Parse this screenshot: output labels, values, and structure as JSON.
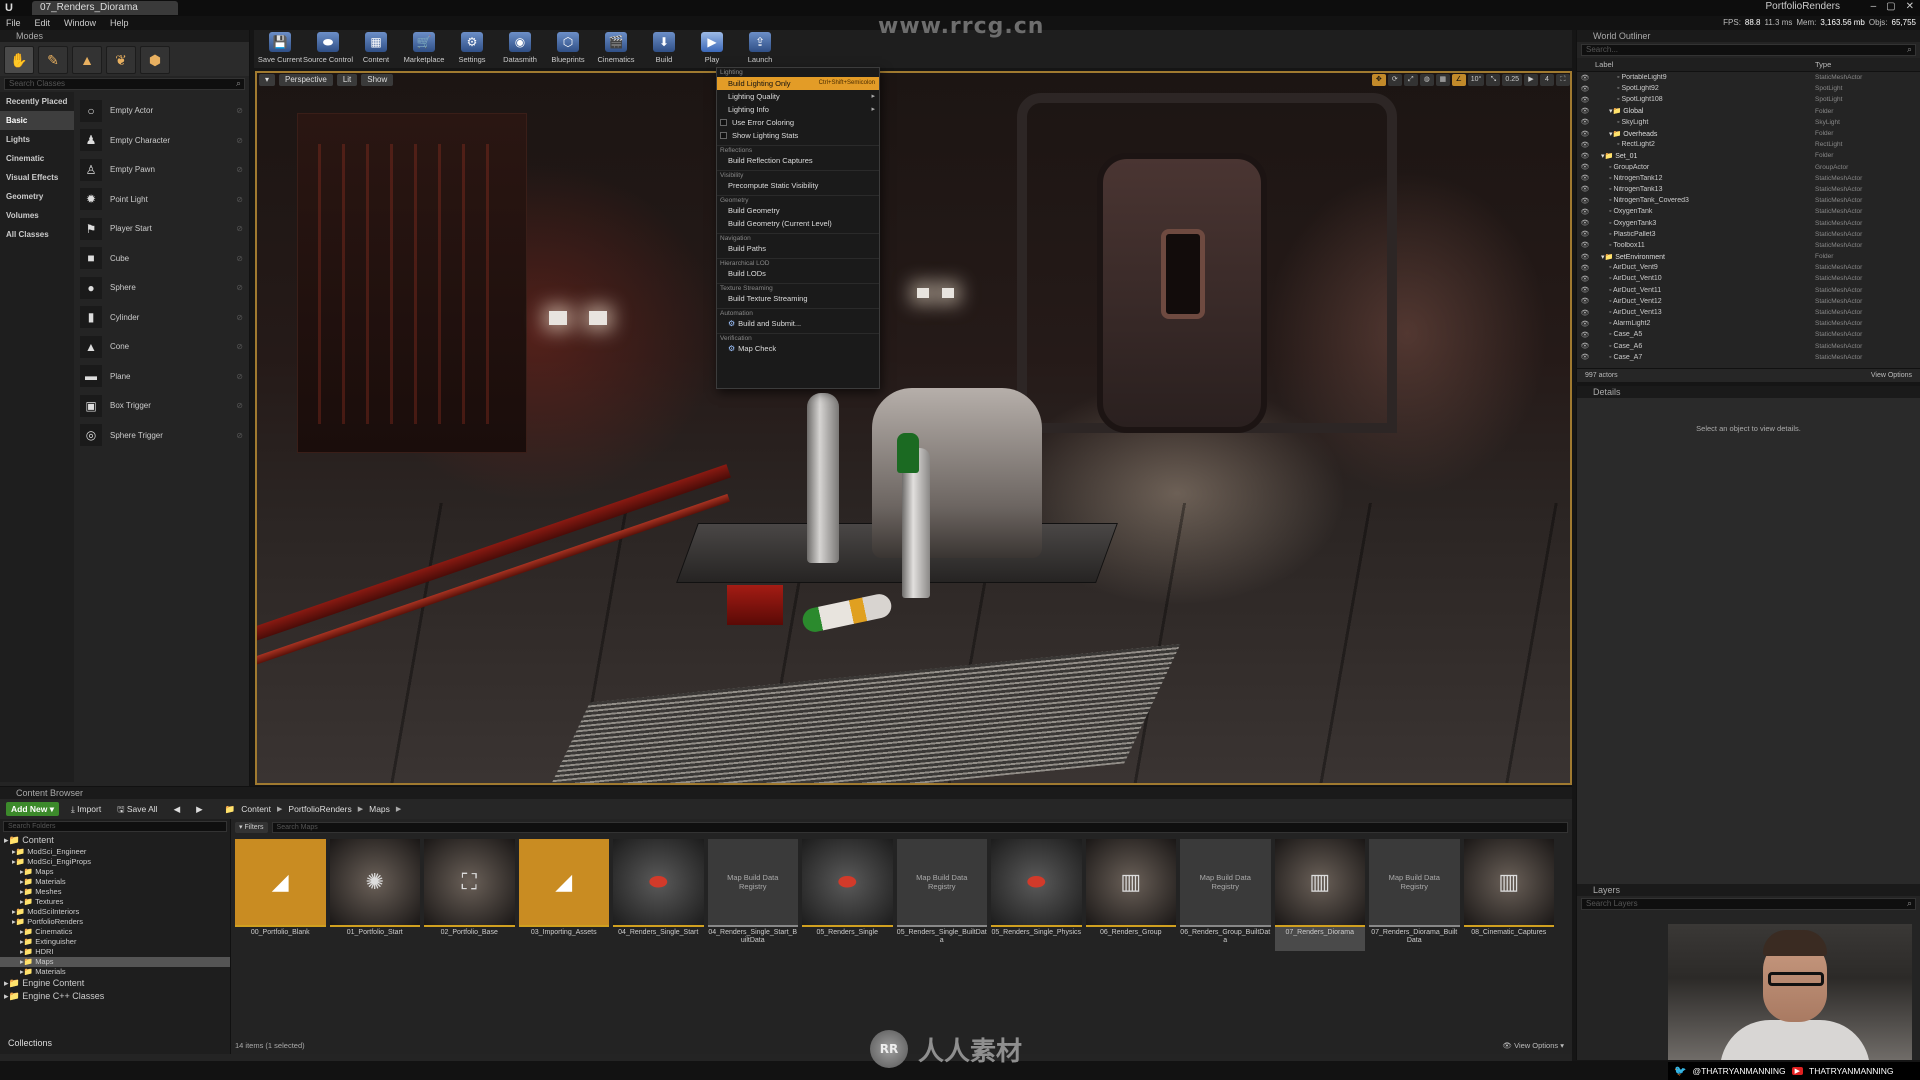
{
  "titlebar": {
    "tab": "07_Renders_Diorama",
    "project": "PortfolioRenders"
  },
  "menu": [
    "File",
    "Edit",
    "Window",
    "Help"
  ],
  "stats": {
    "fps_label": "FPS:",
    "fps": "88.8",
    "ms": "11.3 ms",
    "mem_label": "Mem:",
    "mem": "3,163.56 mb",
    "objs_label": "Objs:",
    "objs": "65,755"
  },
  "modes": {
    "tab": "Modes",
    "search_placeholder": "Search Classes",
    "categories": [
      "Recently Placed",
      "Basic",
      "Lights",
      "Cinematic",
      "Visual Effects",
      "Geometry",
      "Volumes",
      "All Classes"
    ],
    "actors": [
      "Empty Actor",
      "Empty Character",
      "Empty Pawn",
      "Point Light",
      "Player Start",
      "Cube",
      "Sphere",
      "Cylinder",
      "Cone",
      "Plane",
      "Box Trigger",
      "Sphere Trigger"
    ]
  },
  "toolbar": {
    "buttons": [
      "Save Current",
      "Source Control",
      "Content",
      "Marketplace",
      "Settings",
      "Datasmith",
      "Blueprints",
      "Cinematics",
      "Build",
      "Play",
      "Launch"
    ]
  },
  "watermark": {
    "top": "www.rrcg.cn",
    "bottom": "人人素材"
  },
  "viewport": {
    "perspective": "Perspective",
    "lit": "Lit",
    "show": "Show",
    "snap_angle": "10°",
    "scale": "0.25",
    "cam_speed": "4"
  },
  "build_menu": {
    "sections": [
      {
        "title": "Lighting",
        "items": [
          "Build Lighting Only",
          "Lighting Quality",
          "Lighting Info",
          "Use Error Coloring",
          "Show Lighting Stats"
        ]
      },
      {
        "title": "Reflections",
        "items": [
          "Build Reflection Captures"
        ]
      },
      {
        "title": "Visibility",
        "items": [
          "Precompute Static Visibility"
        ]
      },
      {
        "title": "Geometry",
        "items": [
          "Build Geometry",
          "Build Geometry (Current Level)"
        ]
      },
      {
        "title": "Navigation",
        "items": [
          "Build Paths"
        ]
      },
      {
        "title": "Hierarchical LOD",
        "items": [
          "Build LODs"
        ]
      },
      {
        "title": "Texture Streaming",
        "items": [
          "Build Texture Streaming"
        ]
      },
      {
        "title": "Automation",
        "items": [
          "Build and Submit..."
        ]
      },
      {
        "title": "Verification",
        "items": [
          "Map Check"
        ]
      }
    ],
    "shortcut": "Ctrl+Shift+Semicolon"
  },
  "outliner": {
    "tab": "World Outliner",
    "search_placeholder": "Search...",
    "col_label": "Label",
    "col_type": "Type",
    "rows": [
      {
        "name": "PortableLight9",
        "type": "StaticMeshActor",
        "indent": 3
      },
      {
        "name": "SpotLight92",
        "type": "SpotLight",
        "indent": 3
      },
      {
        "name": "SpotLight108",
        "type": "SpotLight",
        "indent": 3
      },
      {
        "name": "Global",
        "type": "Folder",
        "indent": 2
      },
      {
        "name": "SkyLight",
        "type": "SkyLight",
        "indent": 3
      },
      {
        "name": "Overheads",
        "type": "Folder",
        "indent": 2
      },
      {
        "name": "RectLight2",
        "type": "RectLight",
        "indent": 3
      },
      {
        "name": "Set_01",
        "type": "Folder",
        "indent": 1
      },
      {
        "name": "GroupActor",
        "type": "GroupActor",
        "indent": 2
      },
      {
        "name": "NitrogenTank12",
        "type": "StaticMeshActor",
        "indent": 2
      },
      {
        "name": "NitrogenTank13",
        "type": "StaticMeshActor",
        "indent": 2
      },
      {
        "name": "NitrogenTank_Covered3",
        "type": "StaticMeshActor",
        "indent": 2
      },
      {
        "name": "OxygenTank",
        "type": "StaticMeshActor",
        "indent": 2
      },
      {
        "name": "OxygenTank3",
        "type": "StaticMeshActor",
        "indent": 2
      },
      {
        "name": "PlasticPallet3",
        "type": "StaticMeshActor",
        "indent": 2
      },
      {
        "name": "Toolbox11",
        "type": "StaticMeshActor",
        "indent": 2
      },
      {
        "name": "SetEnvironment",
        "type": "Folder",
        "indent": 1
      },
      {
        "name": "AirDuct_Vent9",
        "type": "StaticMeshActor",
        "indent": 2
      },
      {
        "name": "AirDuct_Vent10",
        "type": "StaticMeshActor",
        "indent": 2
      },
      {
        "name": "AirDuct_Vent11",
        "type": "StaticMeshActor",
        "indent": 2
      },
      {
        "name": "AirDuct_Vent12",
        "type": "StaticMeshActor",
        "indent": 2
      },
      {
        "name": "AirDuct_Vent13",
        "type": "StaticMeshActor",
        "indent": 2
      },
      {
        "name": "AlarmLight2",
        "type": "StaticMeshActor",
        "indent": 2
      },
      {
        "name": "Case_A5",
        "type": "StaticMeshActor",
        "indent": 2
      },
      {
        "name": "Case_A6",
        "type": "StaticMeshActor",
        "indent": 2
      },
      {
        "name": "Case_A7",
        "type": "StaticMeshActor",
        "indent": 2
      }
    ],
    "count": "997 actors",
    "view_options": "View Options"
  },
  "details": {
    "tab": "Details",
    "message": "Select an object to view details."
  },
  "content_browser": {
    "tab": "Content Browser",
    "add_new": "Add New",
    "import": "Import",
    "save_all": "Save All",
    "path": [
      "Content",
      "PortfolioRenders",
      "Maps"
    ],
    "folder_search": "Search Folders",
    "filters": "Filters",
    "asset_search": "Search Maps",
    "tree": [
      {
        "name": "Content",
        "indent": 0,
        "big": true
      },
      {
        "name": "ModSci_Engineer",
        "indent": 1
      },
      {
        "name": "ModSci_EngiProps",
        "indent": 1
      },
      {
        "name": "Maps",
        "indent": 2
      },
      {
        "name": "Materials",
        "indent": 2
      },
      {
        "name": "Meshes",
        "indent": 2
      },
      {
        "name": "Textures",
        "indent": 2
      },
      {
        "name": "ModSciInteriors",
        "indent": 1
      },
      {
        "name": "PortfolioRenders",
        "indent": 1
      },
      {
        "name": "Cinematics",
        "indent": 2
      },
      {
        "name": "Extinguisher",
        "indent": 2
      },
      {
        "name": "HDRI",
        "indent": 2
      },
      {
        "name": "Maps",
        "indent": 2,
        "sel": true
      },
      {
        "name": "Materials",
        "indent": 2
      },
      {
        "name": "Engine Content",
        "indent": 0,
        "big": true
      },
      {
        "name": "Engine C++ Classes",
        "indent": 0,
        "big": true
      }
    ],
    "collections": "Collections",
    "assets": [
      {
        "name": "00_Portfolio_Blank",
        "kind": "orange",
        "glyph": "◢"
      },
      {
        "name": "01_Portfolio_Start",
        "kind": "scene",
        "glyph": "✺"
      },
      {
        "name": "02_Portfolio_Base",
        "kind": "scene",
        "glyph": "⛶"
      },
      {
        "name": "03_Importing_Assets",
        "kind": "orange",
        "glyph": "◢"
      },
      {
        "name": "04_Renders_Single_Start",
        "kind": "red",
        "glyph": "⬬"
      },
      {
        "name": "04_Renders_Single_Start_BuiltData",
        "kind": "mbdr",
        "glyph": ""
      },
      {
        "name": "05_Renders_Single",
        "kind": "red",
        "glyph": "⬬"
      },
      {
        "name": "05_Renders_Single_BuiltData",
        "kind": "mbdr",
        "glyph": ""
      },
      {
        "name": "05_Renders_Single_Physics",
        "kind": "red",
        "glyph": "⬬"
      },
      {
        "name": "06_Renders_Group",
        "kind": "scene",
        "glyph": "▥"
      },
      {
        "name": "06_Renders_Group_BuiltData",
        "kind": "mbdr",
        "glyph": ""
      },
      {
        "name": "07_Renders_Diorama",
        "kind": "scene",
        "glyph": "▥",
        "sel": true
      },
      {
        "name": "07_Renders_Diorama_BuiltData",
        "kind": "mbdr",
        "glyph": ""
      },
      {
        "name": "08_Cinematic_Captures",
        "kind": "scene",
        "glyph": "▥"
      }
    ],
    "mbdr_label": "Map Build Data Registry",
    "status": "14 items (1 selected)",
    "view_options": "View Options"
  },
  "layers": {
    "tab": "Layers",
    "search_placeholder": "Search Layers"
  },
  "social": {
    "twitter": "@THATRYANMANNING",
    "youtube": "THATRYANMANNING"
  }
}
